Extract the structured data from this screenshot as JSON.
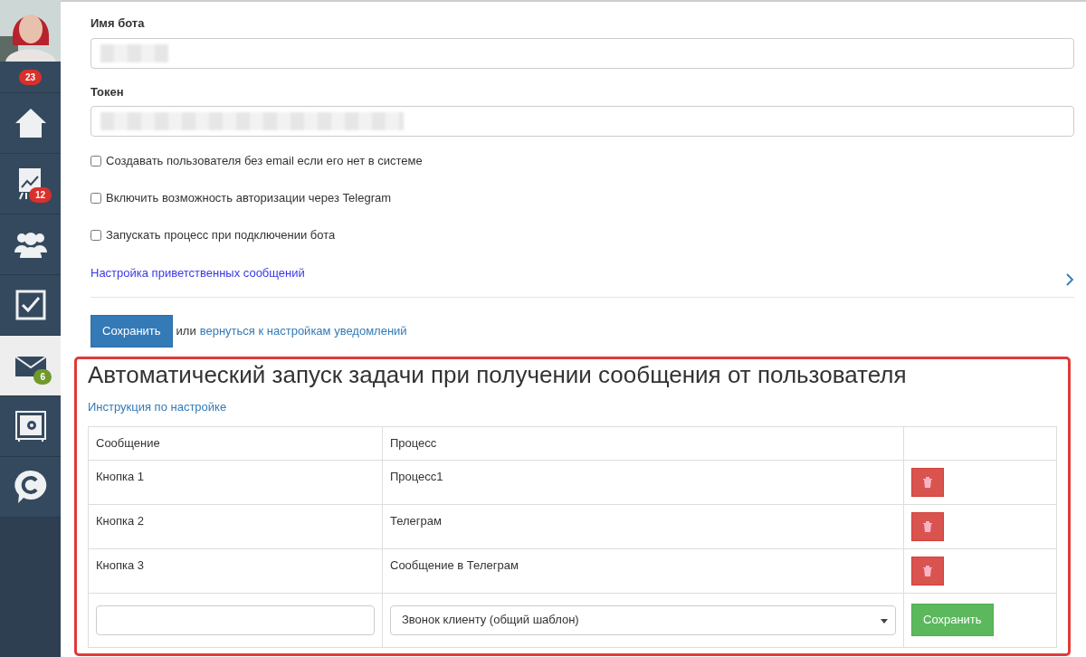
{
  "sidebar": {
    "items": [
      {
        "kind": "counter",
        "selected": false,
        "badge": "23",
        "color": "#d9302c"
      },
      {
        "kind": "home",
        "selected": false
      },
      {
        "kind": "chart",
        "selected": false,
        "badge": "12",
        "color": "#d9302c"
      },
      {
        "kind": "users",
        "selected": false
      },
      {
        "kind": "tasks",
        "selected": false
      },
      {
        "kind": "mail",
        "selected": true,
        "badge": "6",
        "color": "#6f9a2b"
      },
      {
        "kind": "safe",
        "selected": false
      },
      {
        "kind": "chat",
        "selected": false
      }
    ]
  },
  "form": {
    "fields": [
      {
        "label": "Имя бота",
        "redacted": true
      },
      {
        "label": "Токен",
        "redacted": true
      }
    ],
    "checkboxes": [
      {
        "label": "Создавать пользователя без email если его нет в системе",
        "checked": false
      },
      {
        "label": "Включить возможность авторизации через Telegram",
        "checked": false
      },
      {
        "label": "Запускать процесс при подключении бота",
        "checked": false
      }
    ],
    "welcome_link": "Настройка приветственных сообщений",
    "save_button": "Сохранить",
    "or_text": "или",
    "back_link": "вернуться к настройкам уведомлений"
  },
  "section": {
    "highlighted": true,
    "title": "Автоматический запуск задачи при получении сообщения от пользователя",
    "help_link": "Инструкция по настройке",
    "table": {
      "columns": [
        "Сообщение",
        "Процесс"
      ],
      "rows": [
        {
          "message": "Кнопка 1",
          "process": "Процесс1"
        },
        {
          "message": "Кнопка 2",
          "process": "Телеграм"
        },
        {
          "message": "Кнопка 3",
          "process": "Сообщение в Телеграм"
        }
      ],
      "new_row": {
        "process_select": "Звонок клиенту (общий шаблон)",
        "save_button": "Сохранить"
      }
    }
  }
}
